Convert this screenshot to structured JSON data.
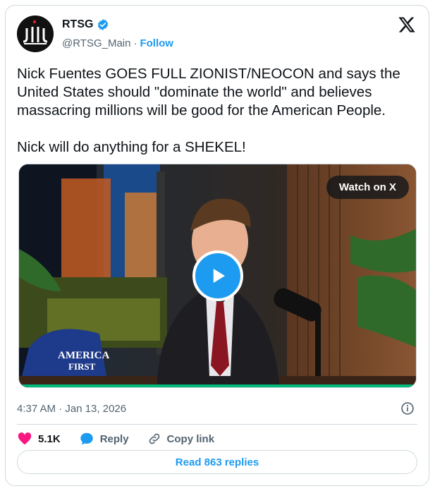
{
  "author": {
    "name": "RTSG",
    "handle": "@RTSG_Main",
    "separator": "·",
    "follow_label": "Follow",
    "verified_icon": "verified-badge-icon",
    "avatar_text": "JiL"
  },
  "tweet": {
    "text": "Nick Fuentes GOES FULL ZIONIST/NEOCON and says the United States should \"dominate the world\" and believes massacring millions will be good for the American People.\n\nNick will do anything for a SHEKEL!",
    "timestamp": "4:37 AM · Jan 13, 2026"
  },
  "media": {
    "watch_label": "Watch on X",
    "hat_text_line1": "AMERICA",
    "hat_text_line2": "FIRST"
  },
  "actions": {
    "like_count": "5.1K",
    "reply_label": "Reply",
    "copy_label": "Copy link"
  },
  "read_replies_label": "Read 863 replies",
  "colors": {
    "accent": "#1d9bf0",
    "like": "#f91880",
    "border": "#cfd9de",
    "secondary_text": "#536471"
  }
}
